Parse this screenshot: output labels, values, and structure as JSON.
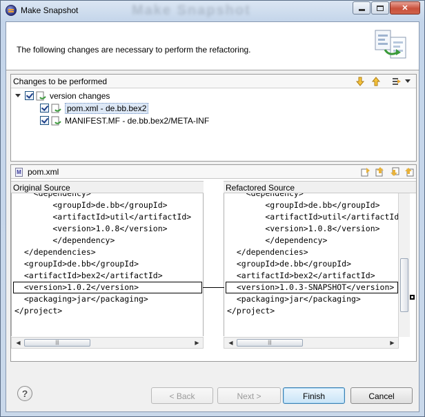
{
  "window": {
    "title": "Make Snapshot",
    "background_title": "Make Snapshot"
  },
  "header": {
    "message": "The following changes are necessary to perform the refactoring."
  },
  "changes": {
    "title": "Changes to be performed",
    "tree": [
      {
        "label": "version changes",
        "checked": true,
        "expanded": true
      },
      {
        "label": "pom.xml - de.bb.bex2",
        "checked": true,
        "selected": true
      },
      {
        "label": "MANIFEST.MF - de.bb.bex2/META-INF",
        "checked": true
      }
    ]
  },
  "compare": {
    "file_title": "pom.xml",
    "original_label": "Original Source",
    "refactored_label": "Refactored Source",
    "original_lines": [
      "    <dependency>",
      "        <groupId>de.bb</groupId>",
      "        <artifactId>util</artifactId>",
      "        <version>1.0.8</version>",
      "        </dependency>",
      "  </dependencies>",
      "  <groupId>de.bb</groupId>",
      "  <artifactId>bex2</artifactId>",
      "  <version>1.0.2</version>",
      "  <packaging>jar</packaging>",
      "</project>"
    ],
    "refactored_lines": [
      "    <dependency>",
      "        <groupId>de.bb</groupId>",
      "        <artifactId>util</artifactId>",
      "        <version>1.0.8</version>",
      "        </dependency>",
      "  </dependencies>",
      "  <groupId>de.bb</groupId>",
      "  <artifactId>bex2</artifactId>",
      "  <version>1.0.3-SNAPSHOT</version>",
      "  <packaging>jar</packaging>",
      "</project>"
    ],
    "changed_line": 8
  },
  "buttons": {
    "back": "< Back",
    "next": "Next >",
    "finish": "Finish",
    "cancel": "Cancel"
  },
  "colors": {
    "accent": "#3c7fb1",
    "selection": "#dde8f6",
    "close": "#c9513c"
  }
}
